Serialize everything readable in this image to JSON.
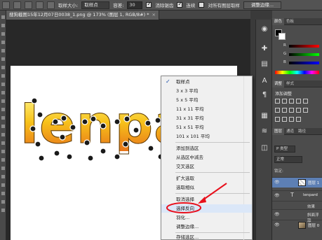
{
  "options_bar": {
    "sample_size_label": "取样大小:",
    "sample_size_value": "取样点",
    "tolerance_label": "容差:",
    "tolerance_value": "30",
    "antialias_label": "消除锯齿",
    "contiguous_label": "连续",
    "sample_all_label": "对所有图层取样",
    "refine_edge_label": "调整边缘..."
  },
  "document_tab": {
    "title": "搜狗截图15年12月07日0038_1.png @ 173% (图层 1, RGB/8#) *",
    "close": "×"
  },
  "canvas": {
    "word": "lenpa"
  },
  "context_menu": {
    "items": [
      {
        "label": "取样点",
        "checked": true,
        "check_glyph": "✓"
      },
      {
        "label": "3 x 3 平均"
      },
      {
        "label": "5 x 5 平均"
      },
      {
        "label": "11 x 11 平均"
      },
      {
        "label": "31 x 31 平均"
      },
      {
        "label": "51 x 51 平均"
      },
      {
        "label": "101 x 101 平均"
      },
      {
        "label": "添加到选区"
      },
      {
        "label": "从选区中减去"
      },
      {
        "label": "交叉选区"
      },
      {
        "label": "扩大选取"
      },
      {
        "label": "选取相似"
      },
      {
        "label": "取消选择"
      },
      {
        "label": "选择反向",
        "highlighted": true
      },
      {
        "label": "羽化..."
      },
      {
        "label": "调整边缘..."
      },
      {
        "label": "存储选区..."
      }
    ]
  },
  "annotation": {
    "color": "#e8101c"
  },
  "right_panels": {
    "color_tabs": [
      "颜色",
      "色板"
    ],
    "rgb_labels": [
      "R",
      "G",
      "B"
    ],
    "adjust_tabs": [
      "调整",
      "样式"
    ],
    "adjust_title": "添加调整",
    "layers_tabs": [
      "图层",
      "通道",
      "路径"
    ],
    "layer_kind": "P 类型",
    "blend_mode": "正常",
    "lock_label": "锁定:",
    "layers": [
      {
        "name": "图层 1",
        "selected": true
      },
      {
        "name": "lenpard",
        "type": "text"
      },
      {
        "name": "效果"
      },
      {
        "name": "斜面浮雕"
      },
      {
        "name": "图层 0"
      }
    ]
  },
  "icons": {
    "eye": "👁",
    "text_layer": "T",
    "strip": [
      "◉",
      "✚",
      "▤",
      "A",
      "¶",
      "▦",
      "≋",
      "◫"
    ]
  }
}
